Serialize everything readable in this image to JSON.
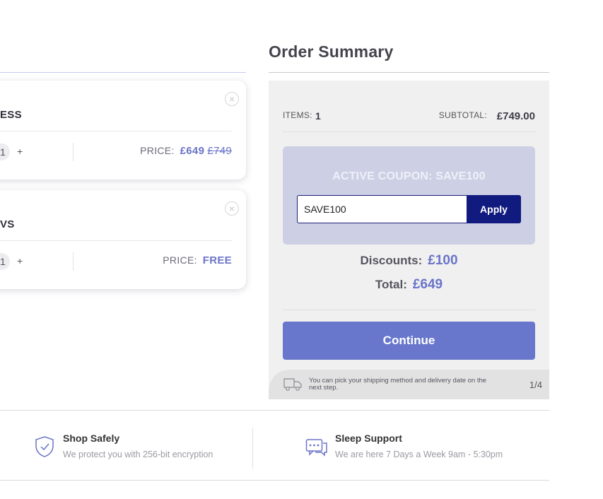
{
  "cart": {
    "items": [
      {
        "name": "ESS",
        "remove_icon": "close-circle-icon",
        "quantity": "1",
        "plus": "+",
        "price_label": "PRICE:",
        "price": "£649",
        "old_price": "£749"
      },
      {
        "name": "VS",
        "remove_icon": "close-circle-icon",
        "quantity": "1",
        "plus": "+",
        "price_label": "PRICE:",
        "price": "FREE"
      }
    ]
  },
  "summary": {
    "title": "Order Summary",
    "items_label": "ITEMS:",
    "items_count": "1",
    "subtotal_label": "SUBTOTAL:",
    "subtotal": "£749.00",
    "coupon_title": "ACTIVE COUPON: SAVE100",
    "coupon_value": "SAVE100",
    "apply_label": "Apply",
    "discounts_label": "Discounts:",
    "discounts": "£100",
    "total_label": "Total:",
    "total": "£649",
    "continue_label": "Continue",
    "shipping_note": "You can pick your shipping method and delivery date on the next step.",
    "pager": "1/4"
  },
  "footer": {
    "features": [
      {
        "title": "Shop Safely",
        "desc": "We protect you with 256-bit encryption",
        "icon": "shield-check-icon"
      },
      {
        "title": "Sleep Support",
        "desc": "We are here 7 Days a Week 9am - 5:30pm",
        "icon": "chat-bubbles-icon"
      }
    ]
  },
  "colors": {
    "accent": "#6877cc",
    "apply_button": "#111a7f",
    "coupon_box": "#cdcfe4",
    "price": "#6a74c8"
  }
}
